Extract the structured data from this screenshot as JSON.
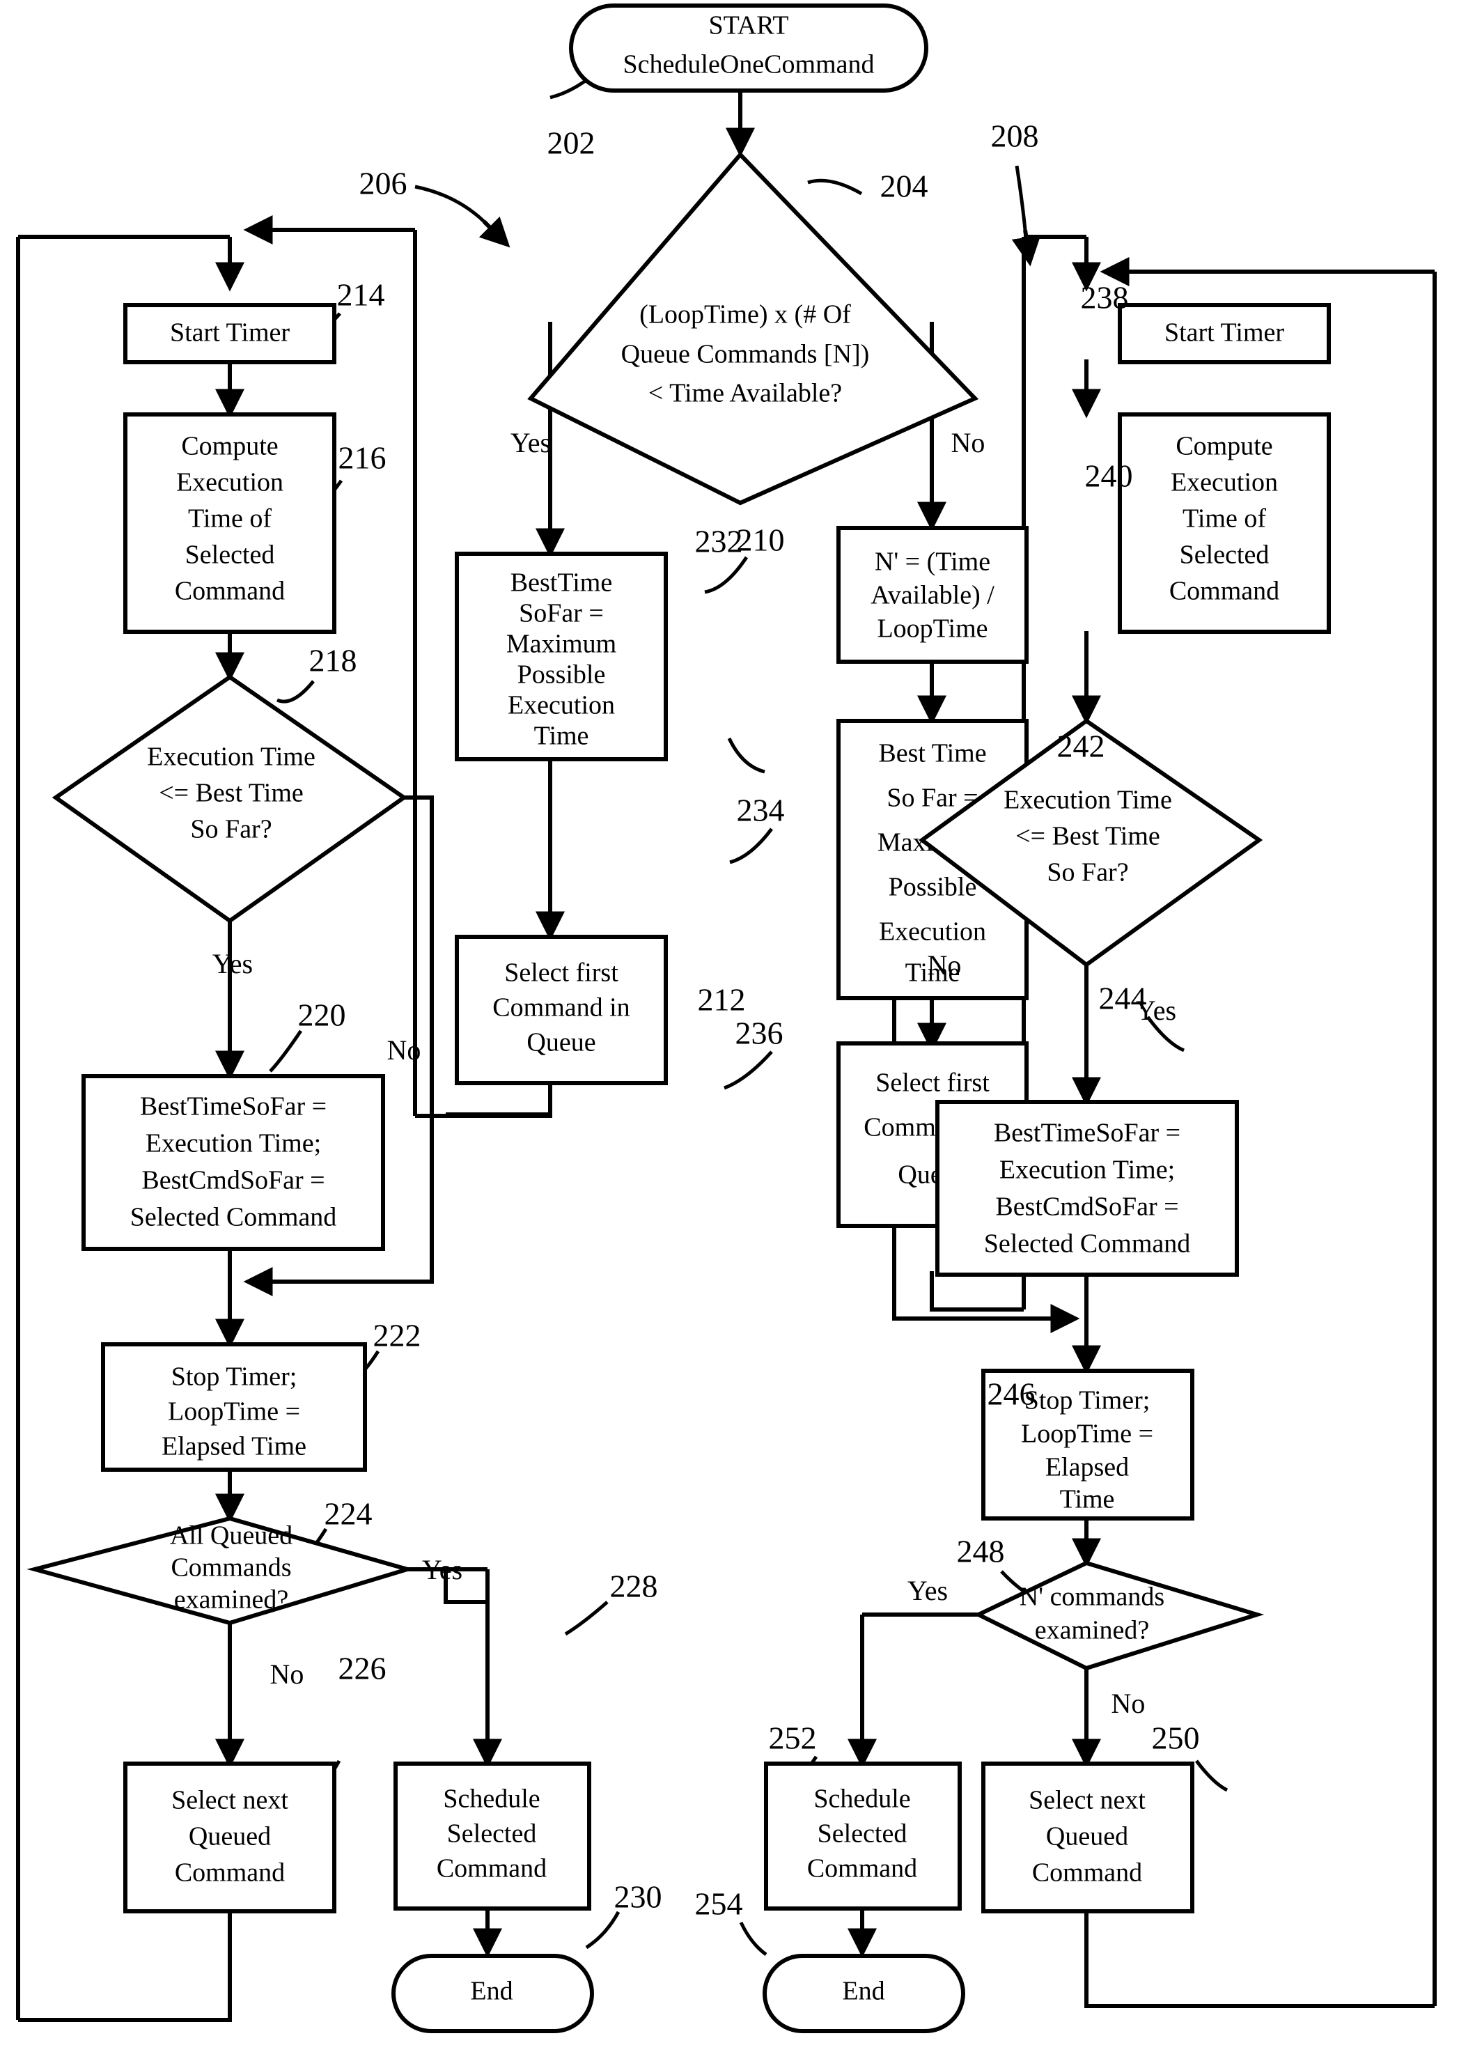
{
  "figure": {
    "type": "flowchart",
    "title": "START ScheduleOneCommand",
    "accent_color": "#000000",
    "background_color": "#ffffff"
  },
  "nodes": {
    "start": {
      "ref": "202",
      "shape": "terminator",
      "line1": "START",
      "line2": "ScheduleOneCommand"
    },
    "decision_204": {
      "ref": "204",
      "shape": "decision",
      "line1": "(LoopTime) x (# Of",
      "line2": "Queue Commands [N])",
      "line3": "< Time Available?",
      "yes_label": "Yes",
      "no_label": "No"
    },
    "branch_206": {
      "ref": "206"
    },
    "branch_208": {
      "ref": "208"
    },
    "box_210": {
      "ref": "210",
      "shape": "process",
      "lines": [
        "BestTime",
        "SoFar =",
        "Maximum",
        "Possible",
        "Execution",
        "Time"
      ]
    },
    "box_212": {
      "ref": "212",
      "shape": "process",
      "lines": [
        "Select  first",
        "Command in",
        "Queue"
      ]
    },
    "box_214": {
      "ref": "214",
      "shape": "process",
      "lines": [
        "Start Timer"
      ]
    },
    "box_216": {
      "ref": "216",
      "shape": "process",
      "lines": [
        "Compute",
        "Execution",
        "Time of",
        "Selected",
        "Command"
      ]
    },
    "decision_218": {
      "ref": "218",
      "shape": "decision",
      "line1": "Execution Time",
      "line2": "<= Best Time",
      "line3": "So Far?",
      "yes_label": "Yes",
      "no_label": "No"
    },
    "box_220": {
      "ref": "220",
      "shape": "process",
      "lines": [
        "BestTimeSoFar =",
        "Execution Time;",
        "BestCmdSoFar =",
        "Selected Command"
      ]
    },
    "box_222": {
      "ref": "222",
      "shape": "process",
      "lines": [
        "Stop Timer;",
        "LoopTime =",
        "Elapsed Time"
      ]
    },
    "decision_224": {
      "ref": "224",
      "shape": "decision",
      "line1": "All Queued",
      "line2": "Commands",
      "line3": "examined?",
      "yes_label": "Yes",
      "no_label": "No"
    },
    "box_226": {
      "ref": "226",
      "shape": "process",
      "lines": [
        "Select  next",
        "Queued",
        "Command"
      ]
    },
    "box_228": {
      "ref": "228",
      "shape": "process",
      "lines": [
        "Schedule",
        "Selected",
        "Command"
      ]
    },
    "end_230": {
      "ref": "230",
      "shape": "terminator",
      "lines": [
        "End"
      ]
    },
    "box_232": {
      "ref": "232",
      "shape": "process",
      "lines": [
        "N' = (Time",
        "Available) /",
        "LoopTime"
      ]
    },
    "box_234": {
      "ref": "234",
      "shape": "process",
      "lines": [
        "Best Time",
        "So Far =",
        "Maximum",
        "Possible",
        "Execution",
        "Time"
      ]
    },
    "box_236": {
      "ref": "236",
      "shape": "process",
      "lines": [
        "Select first",
        "Command in",
        "Queue"
      ]
    },
    "box_238": {
      "ref": "238",
      "shape": "process",
      "lines": [
        "Start Timer"
      ]
    },
    "box_240": {
      "ref": "240",
      "shape": "process",
      "lines": [
        "Compute",
        "Execution",
        "Time of",
        "Selected",
        "Command"
      ]
    },
    "decision_242": {
      "ref": "242",
      "shape": "decision",
      "line1": "Execution Time",
      "line2": "<= Best Time",
      "line3": "So Far?",
      "yes_label": "Yes",
      "no_label": "No"
    },
    "box_244": {
      "ref": "244",
      "shape": "process",
      "lines": [
        "BestTimeSoFar =",
        "Execution Time;",
        "BestCmdSoFar =",
        "Selected Command"
      ]
    },
    "box_246": {
      "ref": "246",
      "shape": "process",
      "lines": [
        "Stop Timer;",
        "LoopTime =",
        "Elapsed",
        "Time"
      ]
    },
    "decision_248": {
      "ref": "248",
      "shape": "decision",
      "line1": "N' commands",
      "line2": "examined?",
      "yes_label": "Yes",
      "no_label": "No"
    },
    "box_250": {
      "ref": "250",
      "shape": "process",
      "lines": [
        "Select next",
        "Queued",
        "Command"
      ]
    },
    "box_252": {
      "ref": "252",
      "shape": "process",
      "lines": [
        "Schedule",
        "Selected",
        "Command"
      ]
    },
    "end_254": {
      "ref": "254",
      "shape": "terminator",
      "lines": [
        "End"
      ]
    }
  }
}
